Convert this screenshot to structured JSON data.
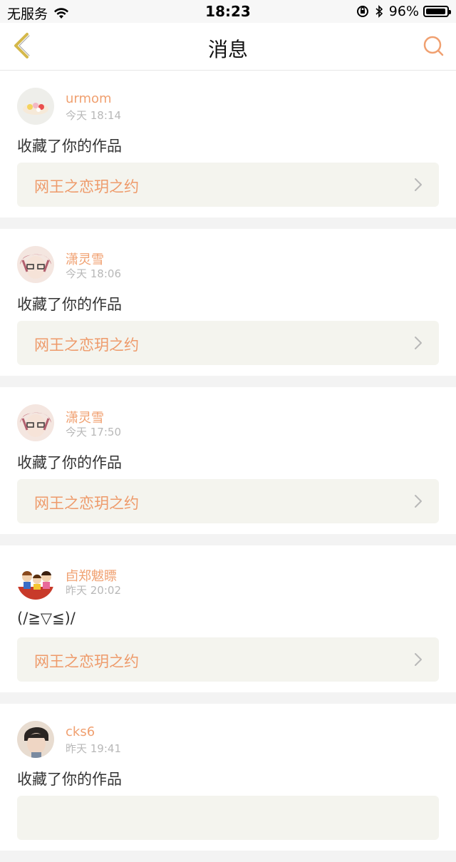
{
  "status_bar": {
    "carrier": "无服务",
    "time": "18:23",
    "battery_text": "96%",
    "battery_level": 0.96
  },
  "nav": {
    "title": "消息",
    "back_icon": "chevron-left-icon",
    "search_icon": "search-icon"
  },
  "colors": {
    "accent": "#f0a070",
    "back_arrow": "#d4b84a",
    "card_link_bg": "#f4f4ee"
  },
  "messages": [
    {
      "username": "urmom",
      "time": "今天 18:14",
      "text": "收藏了你的作品",
      "work_title": "网王之恋玥之约"
    },
    {
      "username": "潇灵雪",
      "time": "今天 18:06",
      "text": "收藏了你的作品",
      "work_title": "网王之恋玥之约"
    },
    {
      "username": "潇灵雪",
      "time": "今天 17:50",
      "text": "收藏了你的作品",
      "work_title": "网王之恋玥之约"
    },
    {
      "username": "卣郑魃瞟",
      "time": "昨天 20:02",
      "text": "(/≧▽≦)/",
      "work_title": "网王之恋玥之约"
    },
    {
      "username": "cks6",
      "time": "昨天 19:41",
      "text": "收藏了你的作品",
      "work_title": ""
    }
  ]
}
